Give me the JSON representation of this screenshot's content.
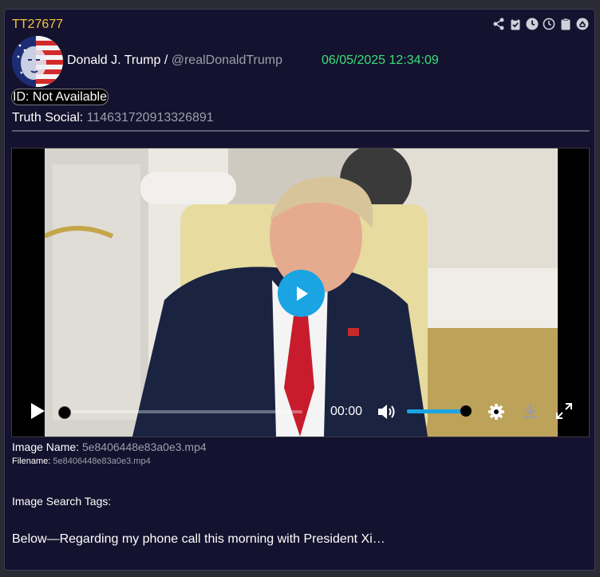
{
  "post": {
    "id": "TT27677",
    "author_name": "Donald J. Trump /",
    "author_handle": "@realDonaldTrump",
    "timestamp": "06/05/2025 12:34:09",
    "id_pill": "ID: Not Available",
    "truth_social_label": "Truth Social:",
    "truth_social_id": "114631720913326891"
  },
  "toolbar": {
    "icons": [
      "share-icon",
      "clipboard-check-icon",
      "clock-filled-icon",
      "clock-outline-icon",
      "clipboard-icon",
      "scroll-top-icon"
    ]
  },
  "video": {
    "current_time": "00:00",
    "volume": 0.9,
    "progress": 0.0
  },
  "media": {
    "image_name_label": "Image Name:",
    "image_name": "5e8406448e83a0e3.mp4",
    "filename_label": "Filename:",
    "filename": "5e8406448e83a0e3.mp4",
    "search_tags_label": "Image Search Tags:"
  },
  "caption": "Below—Regarding my phone call this morning with President Xi…",
  "colors": {
    "accent": "#1ba4e3",
    "post_id": "#f5c542",
    "timestamp": "#39e07a",
    "background": "#14122e"
  }
}
